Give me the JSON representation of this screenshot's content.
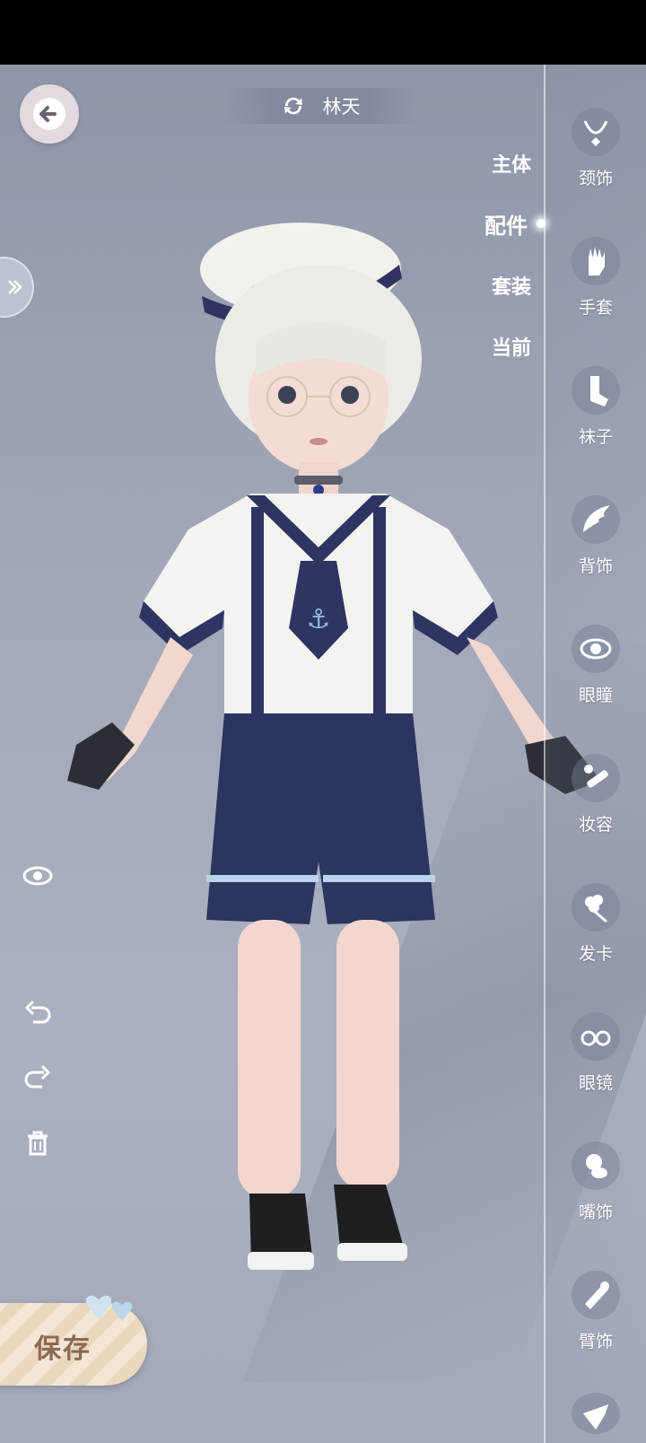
{
  "header": {
    "character_name": "林天",
    "back_icon": "arrow-left-icon",
    "switch_icon": "swap-icon"
  },
  "category_tabs": [
    {
      "label": "主体",
      "active": false
    },
    {
      "label": "配件",
      "active": true
    },
    {
      "label": "套装",
      "active": false
    },
    {
      "label": "当前",
      "active": false
    }
  ],
  "accessory_slots": [
    {
      "label": "颈饰",
      "icon": "necklace-icon"
    },
    {
      "label": "手套",
      "icon": "glove-icon"
    },
    {
      "label": "袜子",
      "icon": "sock-icon"
    },
    {
      "label": "背饰",
      "icon": "wing-icon"
    },
    {
      "label": "眼瞳",
      "icon": "eye-icon"
    },
    {
      "label": "妆容",
      "icon": "makeup-icon"
    },
    {
      "label": "发卡",
      "icon": "hairpin-icon"
    },
    {
      "label": "眼镜",
      "icon": "glasses-icon"
    },
    {
      "label": "嘴饰",
      "icon": "pacifier-icon"
    },
    {
      "label": "臂饰",
      "icon": "armband-icon"
    },
    {
      "label": "",
      "icon": "hat-icon"
    }
  ],
  "tools": {
    "visibility_icon": "eye-toggle-icon",
    "undo_icon": "undo-icon",
    "redo_icon": "redo-icon",
    "delete_icon": "trash-icon"
  },
  "save": {
    "label": "保存"
  },
  "colors": {
    "accent": "#ffffff",
    "save_button": "#f3e6d4",
    "save_text": "#8a6b57",
    "background": "#a3a9ba"
  }
}
